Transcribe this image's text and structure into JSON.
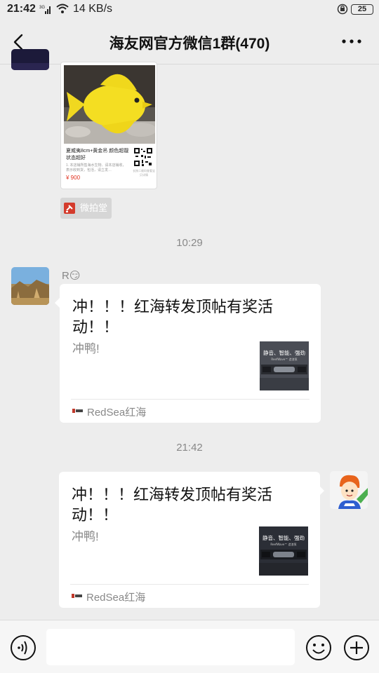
{
  "status_bar": {
    "time": "21:42",
    "network_speed": "14 KB/s",
    "battery_level": "25"
  },
  "header": {
    "title": "海友网官方微信1群(470)"
  },
  "messages": {
    "product_card": {
      "title": "夏威夷8cm+黄金吊 颜色超靓状态超好",
      "description": "1. 本店铺所售海水生物、请本店铺收，表示收到货，包活，请立发…",
      "price": "¥ 900",
      "qr_caption": "长按二维码查看宝贝详情"
    },
    "mini_program_label": "微拍堂",
    "timestamp_1": "10:29",
    "incoming": {
      "sender_name": "R😏",
      "card_title": "冲！！！红海转发顶帖有奖活动！！",
      "card_desc": "冲鸭!",
      "thumb_text": "静音、智能、强劲",
      "thumb_subtext": "ReefWave™ 造浪泵",
      "source_name": "RedSea红海"
    },
    "timestamp_2": "21:42",
    "outgoing": {
      "card_title": "冲！！！红海转发顶帖有奖活动！！",
      "card_desc": "冲鸭!",
      "thumb_text": "静音、智能、强劲",
      "thumb_subtext": "ReefWave™ 造浪泵",
      "source_name": "RedSea红海"
    }
  },
  "input_bar": {
    "text_value": ""
  },
  "colors": {
    "background": "#ededed",
    "bubble": "#ffffff",
    "price": "#e0301e",
    "secondary_text": "#888888"
  }
}
